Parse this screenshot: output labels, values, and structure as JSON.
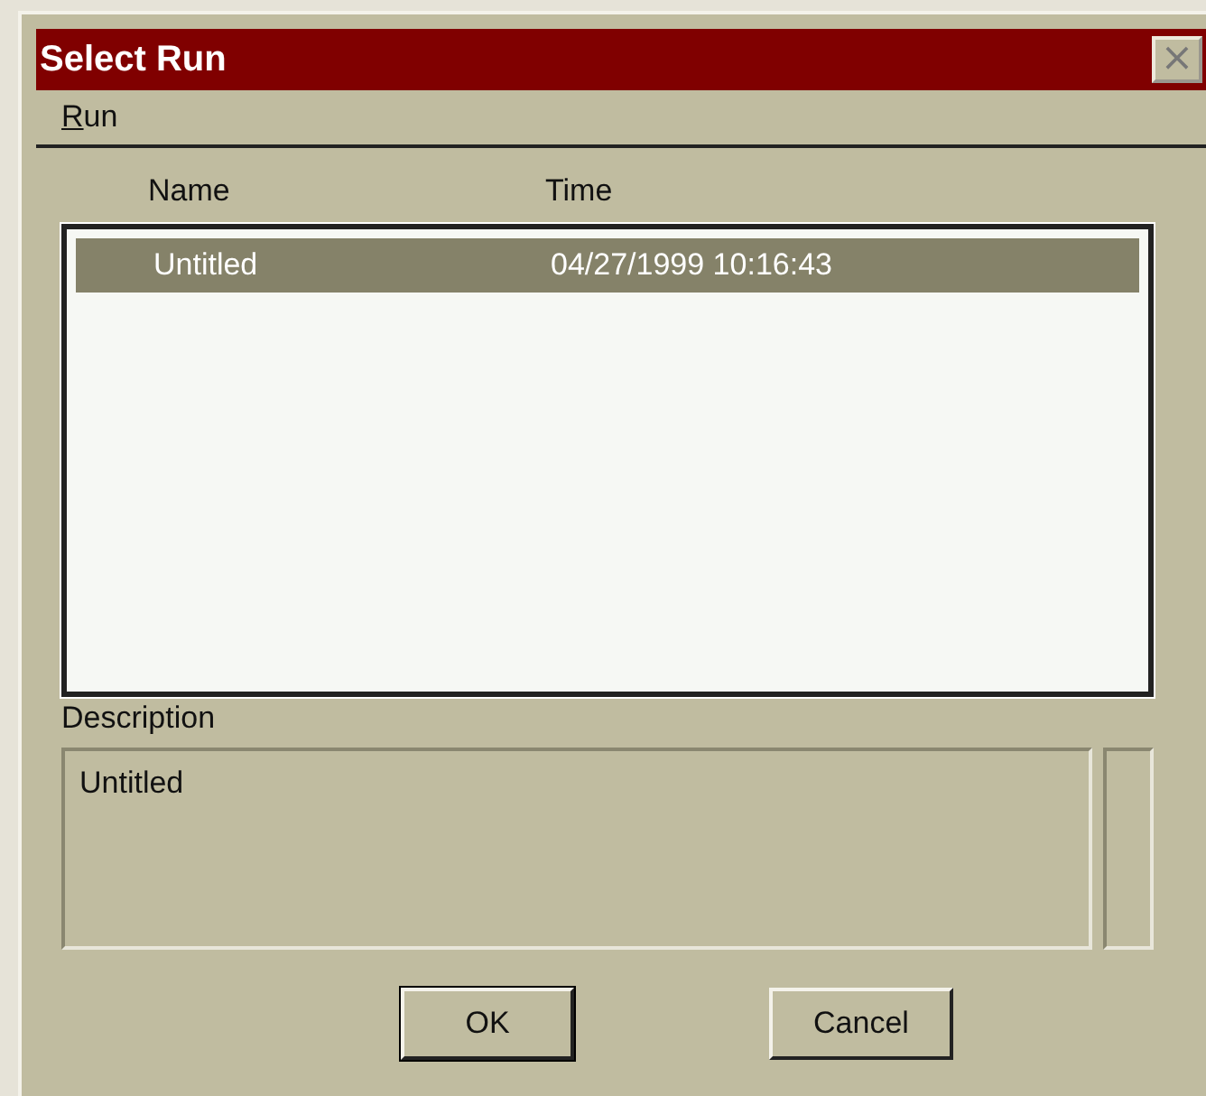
{
  "window": {
    "title": "Select Run",
    "close": "×"
  },
  "menu": [
    {
      "label": "Run",
      "mnemonic_underlined": true
    }
  ],
  "table": {
    "columns": [
      "Name",
      "Time"
    ],
    "rows": [
      {
        "cells": [
          "Untitled",
          "04/27/1999 10:16:43"
        ],
        "selected": true
      }
    ]
  },
  "description": {
    "label": "Description",
    "value": "Untitled"
  },
  "buttons": [
    {
      "label": "OK",
      "default": true
    },
    {
      "label": "Cancel",
      "default": false
    }
  ]
}
